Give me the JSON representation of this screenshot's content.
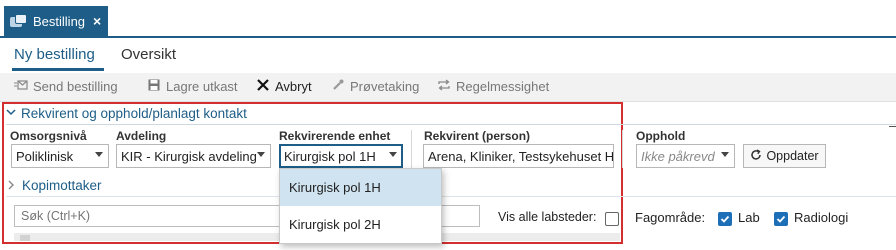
{
  "window": {
    "tab_title": "Bestilling",
    "tab_close": "×"
  },
  "subnav": {
    "tabs": [
      {
        "label": "Ny bestilling",
        "active": true
      },
      {
        "label": "Oversikt",
        "active": false
      }
    ]
  },
  "toolbar": {
    "send": {
      "label": "Send bestilling",
      "icon": "send-order-icon",
      "enabled": false
    },
    "save": {
      "label": "Lagre utkast",
      "icon": "floppy-disk-icon",
      "enabled": false
    },
    "cancel": {
      "label": "Avbryt",
      "icon": "close-icon",
      "enabled": true
    },
    "sample": {
      "label": "Prøvetaking",
      "icon": "pipette-icon",
      "enabled": false
    },
    "recurrence": {
      "label": "Regelmessighet",
      "icon": "repeat-icon",
      "enabled": false
    }
  },
  "section": {
    "title": "Rekvirent og opphold/planlagt kontakt",
    "expanded": true
  },
  "fields": {
    "omsorgsniva": {
      "label": "Omsorgsnivå",
      "value": "Poliklinisk"
    },
    "avdeling": {
      "label": "Avdeling",
      "value": "KIR - Kirurgisk avdeling"
    },
    "rekv_enhet": {
      "label": "Rekvirerende enhet",
      "value": "Kirurgisk pol 1H"
    },
    "rekvirent": {
      "label": "Rekvirent (person)",
      "value": "Arena, Kliniker, Testsykehuset Hf"
    },
    "opphold": {
      "label": "Opphold",
      "placeholder": "Ikke påkrevd"
    },
    "oppdater_label": "Oppdater"
  },
  "dropdown": {
    "options": [
      {
        "label": "Kirurgisk pol 1H",
        "selected": true
      },
      {
        "label": "Kirurgisk pol 2H",
        "selected": false
      }
    ]
  },
  "kopimottaker": {
    "title": "Kopimottaker",
    "expanded": false
  },
  "filters": {
    "search_placeholder": "Søk (Ctrl+K)",
    "vis_alle_label": "Vis alle labsteder:",
    "vis_alle_checked": false,
    "fagomrade_label": "Fagområde:",
    "lab_label": "Lab",
    "lab_checked": true,
    "radiologi_label": "Radiologi",
    "radiologi_checked": true
  },
  "colors": {
    "accent": "#1d5d87",
    "highlight_frame": "#d32f2f",
    "checkbox_checked": "#1d6fb8",
    "dropdown_selected": "#cfe3f0"
  }
}
